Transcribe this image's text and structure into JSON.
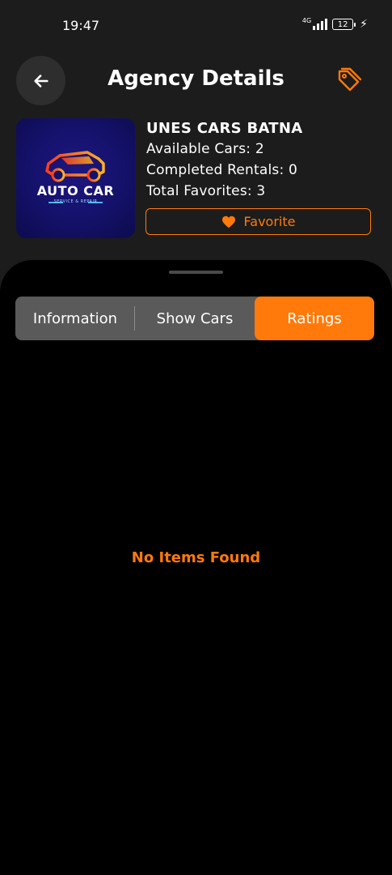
{
  "status_bar": {
    "time": "19:47",
    "network": "4G",
    "battery": "12"
  },
  "header": {
    "title": "Agency Details"
  },
  "agency": {
    "logo_title": "AUTO CAR",
    "logo_subtitle": "SERVICE & REPAIR",
    "name": "UNES CARS BATNA",
    "available_cars": "Available Cars: 2",
    "completed_rentals": "Completed Rentals: 0",
    "total_favorites": "Total Favorites: 3",
    "favorite_label": "Favorite"
  },
  "tabs": [
    {
      "label": "Information",
      "active": false
    },
    {
      "label": "Show Cars",
      "active": false
    },
    {
      "label": "Ratings",
      "active": true
    }
  ],
  "content": {
    "empty_message": "No Items Found"
  },
  "colors": {
    "accent": "#ff7a0a",
    "background": "#1c1c1c",
    "sheet": "#000000",
    "tab_bg": "#5a5a5a"
  },
  "icons": {
    "back": "arrow-left-icon",
    "tag": "tag-icon",
    "favorite": "heart-icon",
    "logo_car": "car-icon"
  }
}
